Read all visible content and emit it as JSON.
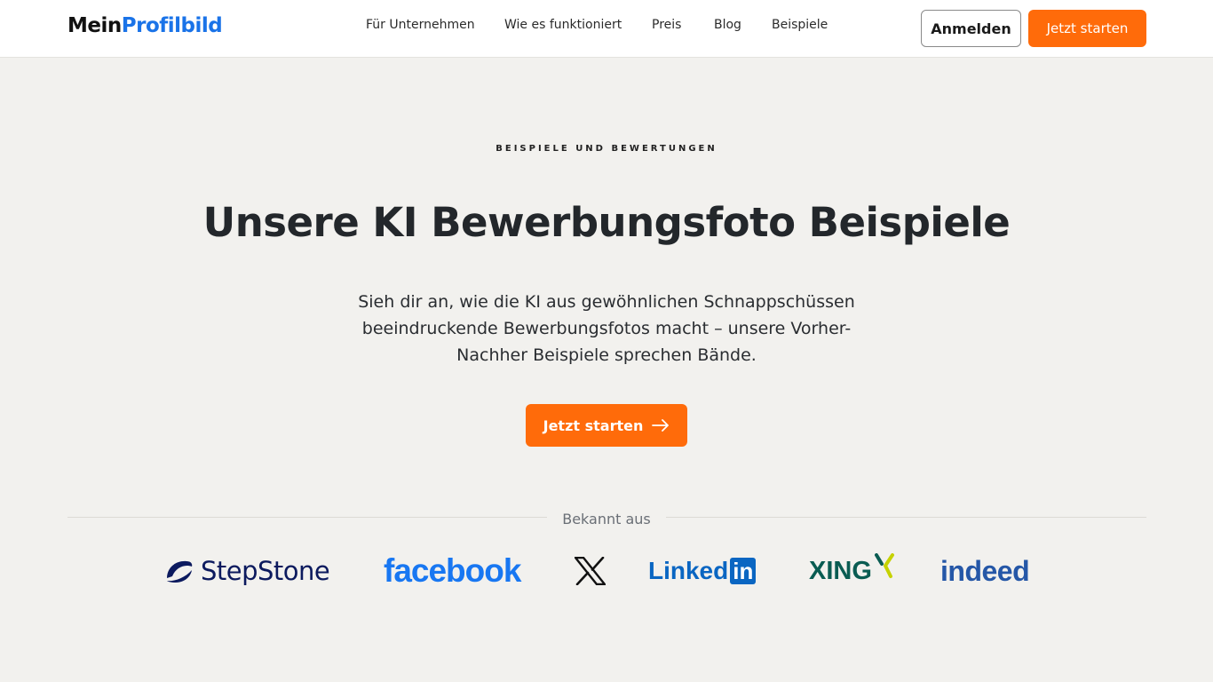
{
  "header": {
    "logo_part1": "Mein",
    "logo_part2": "Profilbild",
    "nav": [
      {
        "label": "Für Unternehmen"
      },
      {
        "label": "Wie es funktioniert"
      },
      {
        "label": "Preis"
      },
      {
        "label": "Blog"
      },
      {
        "label": "Beispiele"
      }
    ],
    "login_label": "Anmelden",
    "start_label": "Jetzt starten"
  },
  "hero": {
    "eyebrow": "BEISPIELE UND BEWERTUNGEN",
    "title": "Unsere KI Bewerbungsfoto Beispiele",
    "subtitle": "Sieh dir an, wie die KI aus gewöhnlichen Schnappschüssen beeindruckende Bewerbungsfotos macht – unsere Vorher-Nachher Beispiele sprechen Bände.",
    "cta_label": "Jetzt starten"
  },
  "press": {
    "label": "Bekannt aus",
    "logos": [
      {
        "name": "StepStone"
      },
      {
        "name": "facebook"
      },
      {
        "name": "X"
      },
      {
        "name": "Linked",
        "badge": "in"
      },
      {
        "name": "XING"
      },
      {
        "name": "indeed"
      }
    ]
  },
  "colors": {
    "accent": "#ff6b0a",
    "brand_blue": "#1a73e8",
    "background": "#f2f1ee"
  }
}
